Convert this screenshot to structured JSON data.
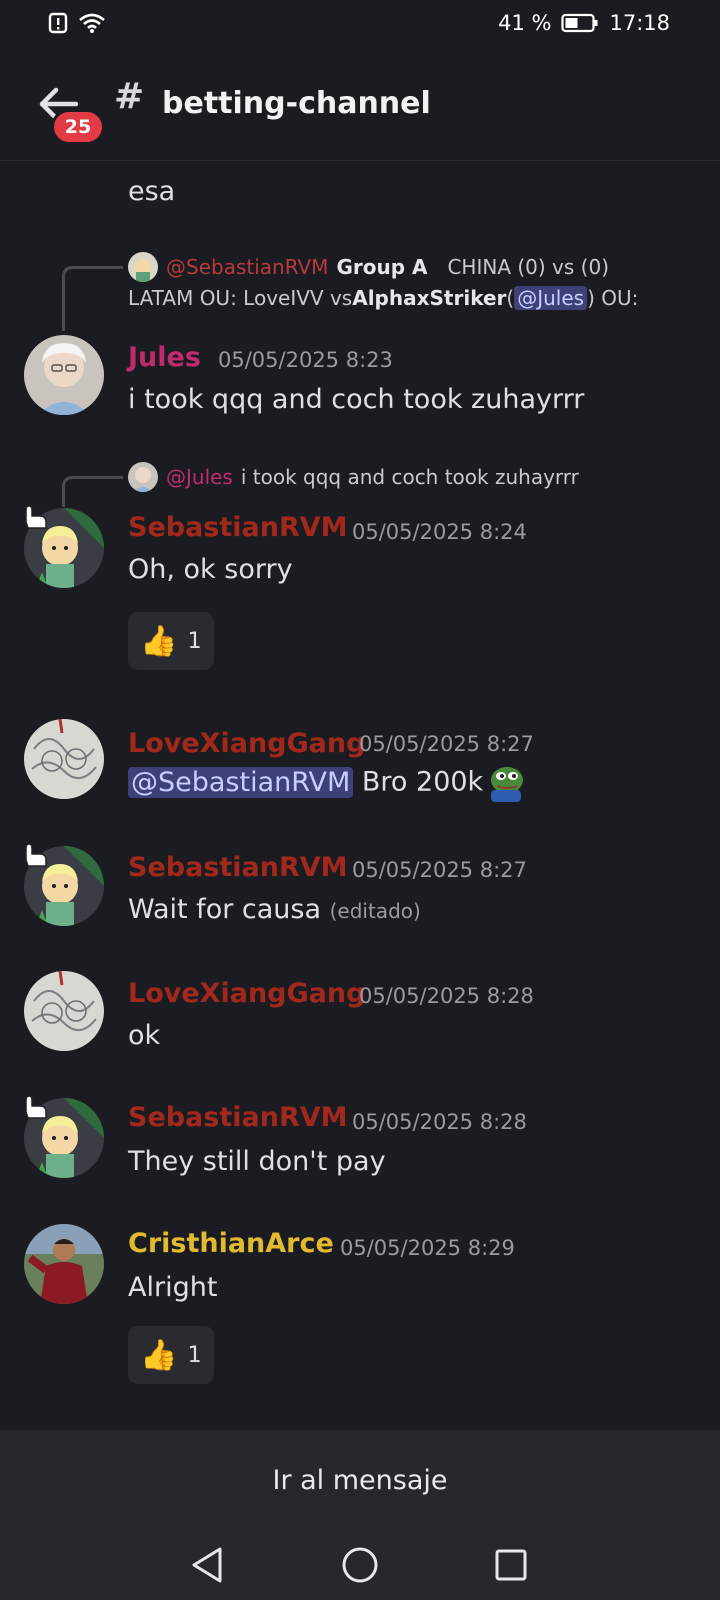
{
  "status_bar": {
    "battery": "41 %",
    "time": "17:18",
    "icons": [
      "alert-icon",
      "wifi-icon",
      "battery-icon"
    ]
  },
  "header": {
    "badge_count": "25",
    "hash": "#",
    "channel_name": "betting-channel"
  },
  "messages": {
    "m0": {
      "text": "esa"
    },
    "m1": {
      "reply": {
        "mention": "@SebastianRVM",
        "line1_bold": "Group A",
        "line1_rest": "CHINA (0) vs (0)",
        "line2_a": "LATAM  OU: LoveIVV vs ",
        "line2_bold": "AlphaxStriker",
        "line2_b": " ( ",
        "line2_mention": "@Jules",
        "line2_c": ") OU:"
      },
      "username": "Jules",
      "username_color": "#c02b6d",
      "timestamp": "05/05/2025 8:23",
      "text": "i took qqq and coch took zuhayrrr"
    },
    "m2": {
      "reply": {
        "mention": "@Jules",
        "text": "i took qqq and coch took zuhayrrr"
      },
      "username": "SebastianRVM",
      "username_color": "#a3281c",
      "timestamp": "05/05/2025 8:24",
      "text": "Oh, ok sorry",
      "reaction": {
        "emoji": "👍",
        "count": "1"
      }
    },
    "m3": {
      "username": "LoveXiangGang",
      "username_color": "#a3281c",
      "timestamp": "05/05/2025 8:27",
      "mention": "@SebastianRVM",
      "text": " Bro 200k"
    },
    "m4": {
      "username": "SebastianRVM",
      "username_color": "#a3281c",
      "timestamp": "05/05/2025 8:27",
      "text": "Wait for causa",
      "edited": "(editado)"
    },
    "m5": {
      "username": "LoveXiangGang",
      "username_color": "#a3281c",
      "timestamp": "05/05/2025 8:28",
      "text": "ok"
    },
    "m6": {
      "username": "SebastianRVM",
      "username_color": "#a3281c",
      "timestamp": "05/05/2025 8:28",
      "text": "They still don't pay"
    },
    "m7": {
      "username": "CristhianArce",
      "username_color": "#e3b92f",
      "timestamp": "05/05/2025 8:29",
      "text": "Alright",
      "reaction": {
        "emoji": "👍",
        "count": "1"
      }
    }
  },
  "jump_to_message": "Ir al mensaje",
  "nav": {
    "icons": [
      "back-triangle-icon",
      "home-circle-icon",
      "recents-square-icon"
    ]
  }
}
